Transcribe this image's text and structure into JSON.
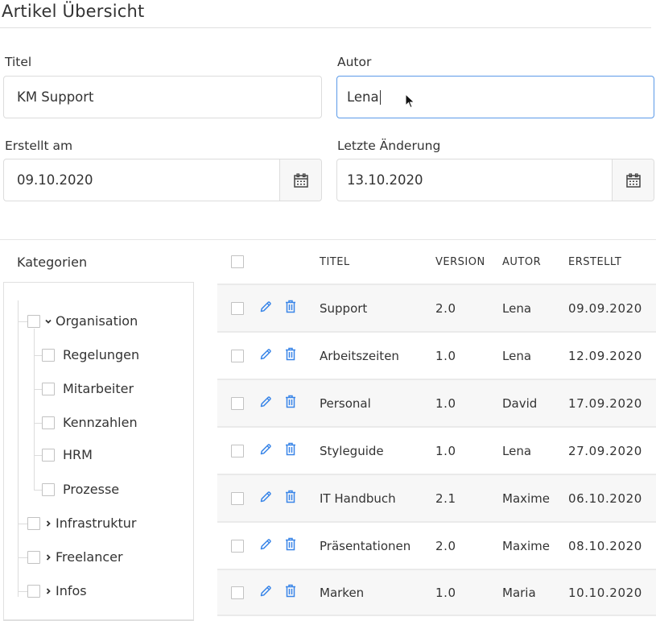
{
  "page": {
    "title": "Artikel Übersicht"
  },
  "form": {
    "titel": {
      "label": "Titel",
      "value": "KM Support"
    },
    "autor": {
      "label": "Autor",
      "value": "Lena",
      "focused": true
    },
    "erstellt_am": {
      "label": "Erstellt am",
      "value": "09.10.2020",
      "icon": "calendar-icon"
    },
    "letzte_aenderung": {
      "label": "Letzte Änderung",
      "value": "13.10.2020",
      "icon": "calendar-icon"
    }
  },
  "categories": {
    "label": "Kategorien",
    "nodes": [
      {
        "label": "Organisation",
        "expanded": true,
        "children": [
          "Regelungen",
          "Mitarbeiter",
          "Kennzahlen",
          "HRM",
          "Prozesse"
        ]
      },
      {
        "label": "Infrastruktur",
        "expanded": false
      },
      {
        "label": "Freelancer",
        "expanded": false
      },
      {
        "label": "Infos",
        "expanded": false
      }
    ]
  },
  "table": {
    "columns": [
      "TITEL",
      "VERSION",
      "AUTOR",
      "ERSTELLT"
    ],
    "row_actions": [
      "edit-icon",
      "trash-icon"
    ],
    "accent_color": "#3a86e8",
    "rows": [
      {
        "titel": "Support",
        "version": "2.0",
        "autor": "Lena",
        "erstellt": "09.09.2020"
      },
      {
        "titel": "Arbeitszeiten",
        "version": "1.0",
        "autor": "Lena",
        "erstellt": "12.09.2020"
      },
      {
        "titel": "Personal",
        "version": "1.0",
        "autor": "David",
        "erstellt": "17.09.2020"
      },
      {
        "titel": "Styleguide",
        "version": "1.0",
        "autor": "Lena",
        "erstellt": "27.09.2020"
      },
      {
        "titel": "IT Handbuch",
        "version": "2.1",
        "autor": "Maxime",
        "erstellt": "06.10.2020"
      },
      {
        "titel": "Präsentationen",
        "version": "2.0",
        "autor": "Maxime",
        "erstellt": "08.10.2020"
      },
      {
        "titel": "Marken",
        "version": "1.0",
        "autor": "Maria",
        "erstellt": "10.10.2020"
      }
    ]
  }
}
